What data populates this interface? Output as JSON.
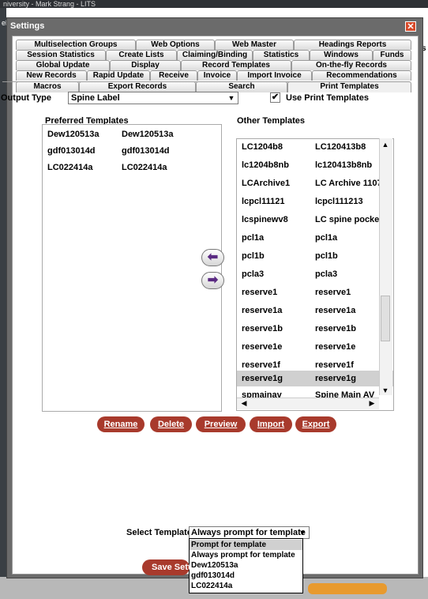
{
  "background": {
    "window_title": "niversity - Mark Strang - LITS",
    "edge_text": "el",
    "right_edge_text": "s"
  },
  "dialog": {
    "title": "Settings",
    "close_label": "✕"
  },
  "tabs": {
    "row1": [
      "Multiselection Groups",
      "Web Options",
      "Web Master",
      "Headings Reports"
    ],
    "row2": [
      "Session Statistics",
      "Create Lists",
      "Claiming/Binding",
      "Statistics",
      "Windows",
      "Funds"
    ],
    "row3": [
      "Global Update",
      "Display",
      "Record Templates",
      "On-the-fly Records"
    ],
    "row4": [
      "New Records",
      "Rapid Update",
      "Receive",
      "Invoice",
      "Import Invoice",
      "Recommendations"
    ],
    "row5": [
      "Macros",
      "Export Records",
      "Search",
      "Print Templates"
    ],
    "active": "Print Templates"
  },
  "output_type": {
    "label": "Output Type",
    "value": "Spine Label",
    "arrow": "▼"
  },
  "use_print_templates": {
    "label": "Use Print Templates",
    "checked": true,
    "check_glyph": "✔"
  },
  "preferred": {
    "label": "Preferred Templates",
    "rows": [
      {
        "name": "Dew120513a",
        "desc": "Dew120513a"
      },
      {
        "name": "gdf013014d",
        "desc": "gdf013014d"
      },
      {
        "name": "LC022414a",
        "desc": "LC022414a"
      }
    ]
  },
  "other": {
    "label": "Other Templates",
    "rows": [
      {
        "name": "LC1204b8",
        "desc": "LC120413b8"
      },
      {
        "name": "lc1204b8nb",
        "desc": "lc120413b8nb"
      },
      {
        "name": "LCArchive1",
        "desc": "LC Archive 11071"
      },
      {
        "name": "lcpcl11121",
        "desc": "lcpcl111213"
      },
      {
        "name": "lcspinewv8",
        "desc": "LC spine pocket"
      },
      {
        "name": "pcl1a",
        "desc": "pcl1a"
      },
      {
        "name": "pcl1b",
        "desc": "pcl1b"
      },
      {
        "name": "pcla3",
        "desc": "pcla3"
      },
      {
        "name": "reserve1",
        "desc": "reserve1"
      },
      {
        "name": "reserve1a",
        "desc": "reserve1a"
      },
      {
        "name": "reserve1b",
        "desc": "reserve1b"
      },
      {
        "name": "reserve1e",
        "desc": "reserve1e"
      },
      {
        "name": "reserve1f",
        "desc": "reserve1f"
      },
      {
        "name": "reserve1g",
        "desc": "reserve1g"
      },
      {
        "name": "spmainav",
        "desc": "Spine Main AV"
      }
    ],
    "selected_index": 13,
    "scroll_up": "▲",
    "scroll_down": "▼",
    "scroll_left": "◀",
    "scroll_right": "▶"
  },
  "arrows": {
    "move_left": "⬅",
    "move_right": "➡"
  },
  "actions": {
    "rename": "Rename",
    "delete": "Delete",
    "preview": "Preview",
    "import": "Import",
    "export": "Export"
  },
  "select_template": {
    "label": "Select Template",
    "value": "Always prompt for template",
    "arrow": "▼",
    "options": [
      "Prompt for template",
      "Always prompt for template",
      "Dew120513a",
      "gdf013014d",
      "LC022414a"
    ],
    "highlighted_index": 0
  },
  "save_button": "Save Setti"
}
